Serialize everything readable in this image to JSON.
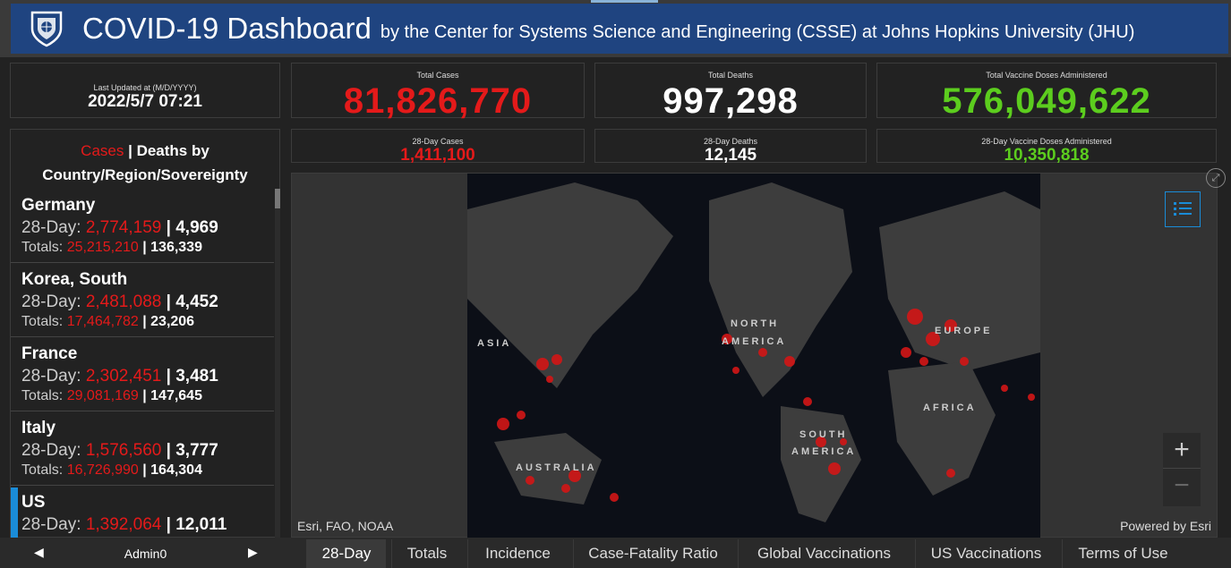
{
  "header": {
    "title": "COVID-19 Dashboard",
    "subtitle": "by the Center for Systems Science and Engineering (CSSE) at Johns Hopkins University (JHU)"
  },
  "last_updated": {
    "label": "Last Updated at (M/D/YYYY)",
    "value": "2022/5/7 07:21"
  },
  "stats": {
    "total_cases_label": "Total Cases",
    "total_cases": "81,826,770",
    "total_deaths_label": "Total Deaths",
    "total_deaths": "997,298",
    "total_vaccine_label": "Total Vaccine Doses Administered",
    "total_vaccine": "576,049,622",
    "cases_28_label": "28-Day Cases",
    "cases_28": "1,411,100",
    "deaths_28_label": "28-Day Deaths",
    "deaths_28": "12,145",
    "vaccine_28_label": "28-Day Vaccine Doses Administered",
    "vaccine_28": "10,350,818"
  },
  "list": {
    "head_cases": "Cases",
    "head_sep": " | ",
    "head_deaths": "Deaths by",
    "head_line2": "Country/Region/Sovereignty",
    "prefix_28": "28-Day: ",
    "prefix_tot": "Totals: ",
    "sep": " | ",
    "rows": [
      {
        "name": "Germany",
        "c28": "2,774,159",
        "d28": "4,969",
        "ct": "25,215,210",
        "dt": "136,339"
      },
      {
        "name": "Korea, South",
        "c28": "2,481,088",
        "d28": "4,452",
        "ct": "17,464,782",
        "dt": "23,206"
      },
      {
        "name": "France",
        "c28": "2,302,451",
        "d28": "3,481",
        "ct": "29,081,169",
        "dt": "147,645"
      },
      {
        "name": "Italy",
        "c28": "1,576,560",
        "d28": "3,777",
        "ct": "16,726,990",
        "dt": "164,304"
      },
      {
        "name": "US",
        "c28": "1,392,064",
        "d28": "12,011",
        "ct": "",
        "dt": ""
      }
    ]
  },
  "map": {
    "credit_left": "Esri, FAO, NOAA",
    "credit_right": "Powered by Esri",
    "labels": [
      "ASIA",
      "NORTH",
      "AMERICA",
      "EUROPE",
      "AFRICA",
      "SOUTH",
      "AMERICA",
      "AUSTRALIA"
    ],
    "zoom_in": "+",
    "zoom_out": "−",
    "icons": [
      "legend-list-icon",
      "expand-icon"
    ]
  },
  "bottom": {
    "nav_label": "Admin0",
    "tabs": [
      "28-Day",
      "Totals",
      "Incidence",
      "Case-Fatality Ratio",
      "Global Vaccinations",
      "US Vaccinations",
      "Terms of Use"
    ],
    "active_tab": "28-Day"
  },
  "colors": {
    "header_bg": "#1f4480",
    "cases_red": "#e41a1a",
    "vaccine_green": "#5ccd1e",
    "accent_blue": "#1a8cd8"
  }
}
